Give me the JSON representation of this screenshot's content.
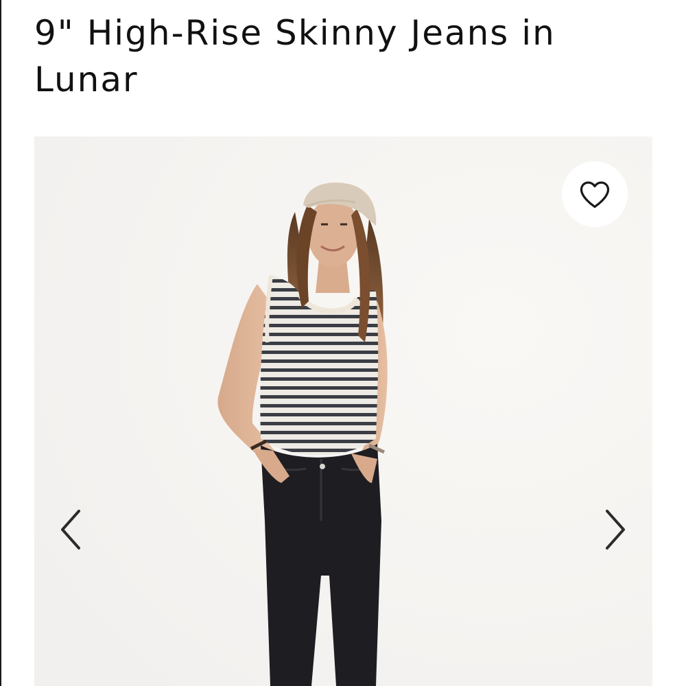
{
  "product": {
    "title": "9\" High-Rise Skinny Jeans in Lunar"
  },
  "gallery": {
    "image": "model-photo",
    "favorite_icon": "heart-outline-icon",
    "prev_icon": "chevron-left-icon",
    "next_icon": "chevron-right-icon"
  },
  "colors": {
    "text": "#111111",
    "gallery_background": "#f6f4f2",
    "icon_stroke": "#1a1a1a",
    "favorite_button_bg": "#ffffff"
  }
}
